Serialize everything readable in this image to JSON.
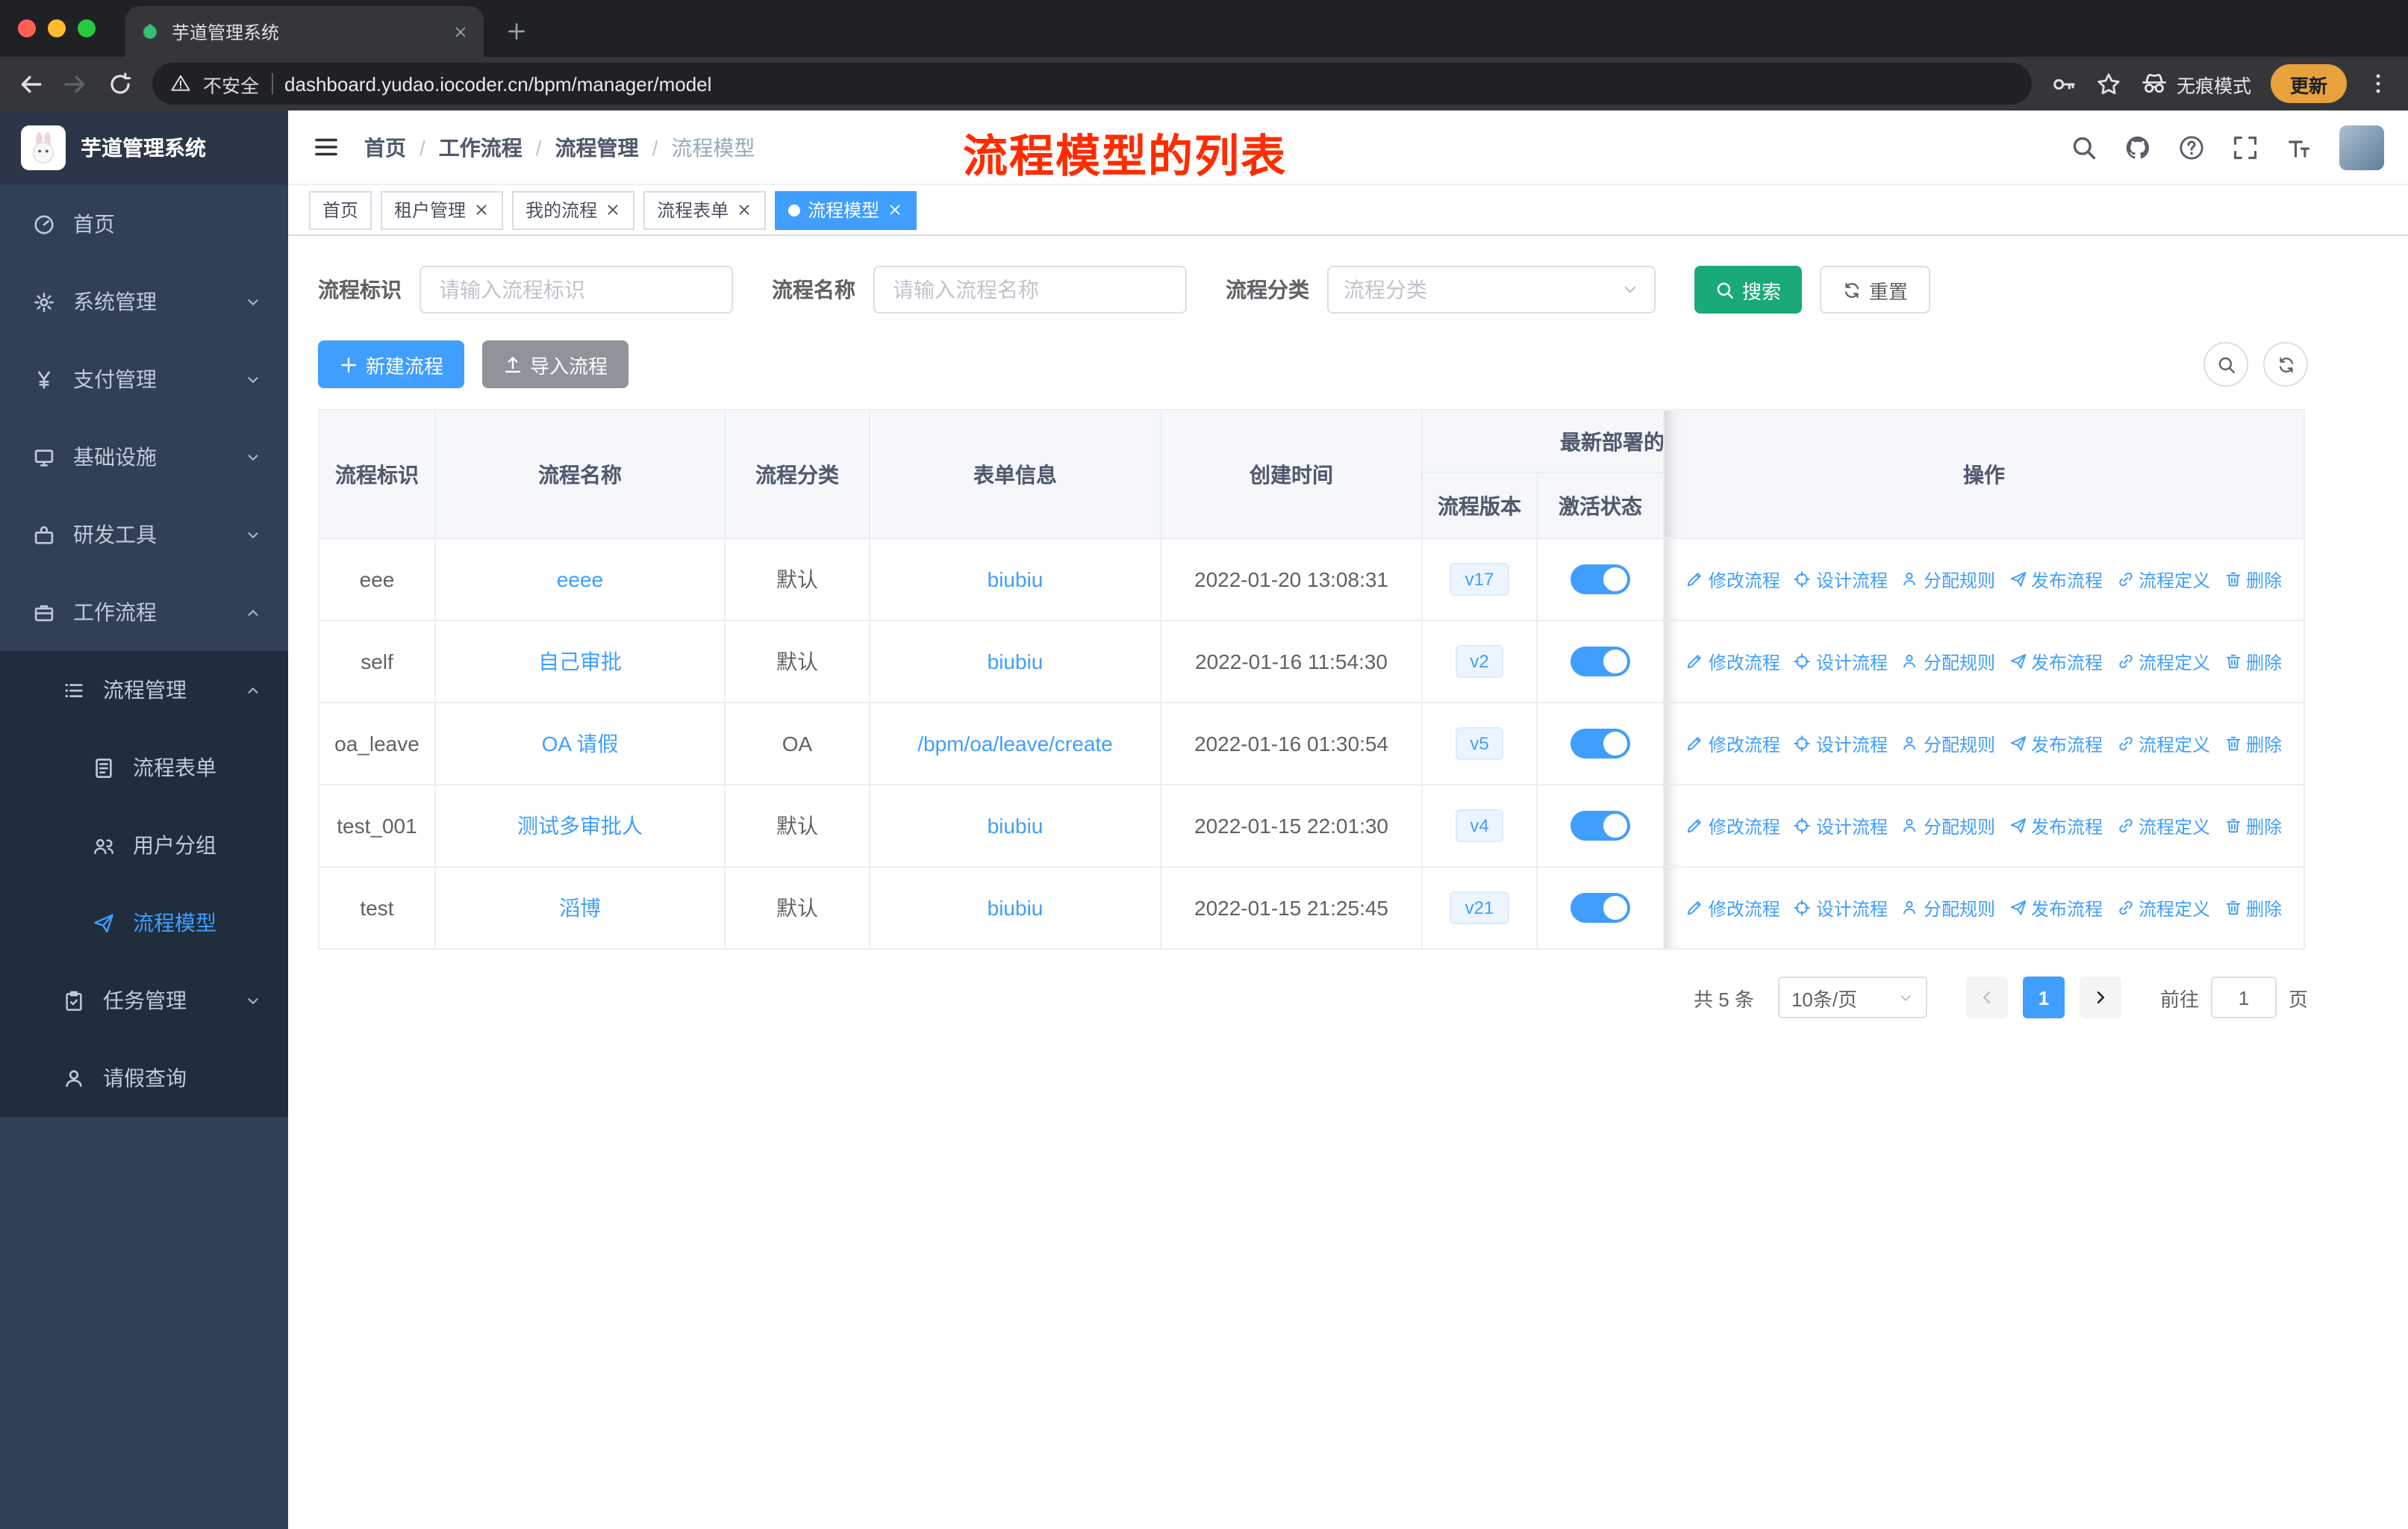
{
  "colors": {
    "primary": "#409EFF",
    "search_button_green": "#1AA97B",
    "import_button_gray": "#909399",
    "sidebar_bg": "#304156",
    "sidebar_submenu_bg": "#1F2D3D",
    "annotation_red": "#FF2C00",
    "active_tag_bg": "#409EFF",
    "toggle_on": "#409EFF",
    "update_pill_orange": "#E8A23C"
  },
  "browser": {
    "tab": {
      "title": "芋道管理系统"
    },
    "address": {
      "security_label": "不安全",
      "url": "dashboard.yudao.iocoder.cn/bpm/manager/model"
    },
    "incognito_label": "无痕模式",
    "update_label": "更新"
  },
  "sidebar": {
    "logo_text": "芋道管理系统",
    "items": [
      {
        "id": "home",
        "label": "首页",
        "icon": "dashboard-icon",
        "level": 1
      },
      {
        "id": "system",
        "label": "系统管理",
        "icon": "gear-icon",
        "level": 1,
        "chevron": "down"
      },
      {
        "id": "payment",
        "label": "支付管理",
        "icon": "yen-icon",
        "level": 1,
        "chevron": "down"
      },
      {
        "id": "infra",
        "label": "基础设施",
        "icon": "infra-icon",
        "level": 1,
        "chevron": "down"
      },
      {
        "id": "devtools",
        "label": "研发工具",
        "icon": "tools-icon",
        "level": 1,
        "chevron": "down"
      },
      {
        "id": "workflow",
        "label": "工作流程",
        "icon": "briefcase-icon",
        "level": 1,
        "chevron": "up"
      },
      {
        "id": "process-manage",
        "label": "流程管理",
        "icon": "list-icon",
        "level": 2,
        "chevron": "up",
        "sub": true
      },
      {
        "id": "process-form",
        "label": "流程表单",
        "icon": "form-icon",
        "level": 3,
        "sub": true
      },
      {
        "id": "user-group",
        "label": "用户分组",
        "icon": "group-icon",
        "level": 3,
        "sub": true
      },
      {
        "id": "process-model",
        "label": "流程模型",
        "icon": "send-icon",
        "level": 3,
        "sub": true,
        "active": true
      },
      {
        "id": "task-manage",
        "label": "任务管理",
        "icon": "task-icon",
        "level": 2,
        "chevron": "down",
        "sub": true
      },
      {
        "id": "leave-query",
        "label": "请假查询",
        "icon": "user-icon",
        "level": 2,
        "sub": true
      }
    ]
  },
  "header": {
    "breadcrumb": [
      "首页",
      "工作流程",
      "流程管理",
      "流程模型"
    ],
    "annotation": "流程模型的列表"
  },
  "tags_view": [
    {
      "label": "首页",
      "closable": false,
      "active": false
    },
    {
      "label": "租户管理",
      "closable": true,
      "active": false
    },
    {
      "label": "我的流程",
      "closable": true,
      "active": false
    },
    {
      "label": "流程表单",
      "closable": true,
      "active": false
    },
    {
      "label": "流程模型",
      "closable": true,
      "active": true
    }
  ],
  "filters": {
    "id": {
      "label": "流程标识",
      "placeholder": "请输入流程标识"
    },
    "name": {
      "label": "流程名称",
      "placeholder": "请输入流程名称"
    },
    "category": {
      "label": "流程分类",
      "placeholder": "流程分类"
    },
    "search_label": "搜索",
    "reset_label": "重置"
  },
  "toolbar": {
    "create_label": "新建流程",
    "import_label": "导入流程"
  },
  "table": {
    "headers": {
      "id": "流程标识",
      "name": "流程名称",
      "category": "流程分类",
      "form": "表单信息",
      "created": "创建时间",
      "deploy_group": "最新部署的",
      "version": "流程版本",
      "status": "激活状态",
      "actions": "操作"
    },
    "rows": [
      {
        "id": "eee",
        "name": "eeee",
        "category": "默认",
        "form": "biubiu",
        "created": "2022-01-20 13:08:31",
        "version": "v17",
        "active": true
      },
      {
        "id": "self",
        "name": "自己审批",
        "category": "默认",
        "form": "biubiu",
        "created": "2022-01-16 11:54:30",
        "version": "v2",
        "active": true
      },
      {
        "id": "oa_leave",
        "name": "OA 请假",
        "category": "OA",
        "form": "/bpm/oa/leave/create",
        "created": "2022-01-16 01:30:54",
        "version": "v5",
        "active": true
      },
      {
        "id": "test_001",
        "name": "测试多审批人",
        "category": "默认",
        "form": "biubiu",
        "created": "2022-01-15 22:01:30",
        "version": "v4",
        "active": true
      },
      {
        "id": "test",
        "name": "滔博",
        "category": "默认",
        "form": "biubiu",
        "created": "2022-01-15 21:25:45",
        "version": "v21",
        "active": true
      }
    ],
    "row_actions": [
      {
        "id": "modify",
        "label": "修改流程",
        "icon": "edit-icon"
      },
      {
        "id": "design",
        "label": "设计流程",
        "icon": "design-icon"
      },
      {
        "id": "assign",
        "label": "分配规则",
        "icon": "assign-icon"
      },
      {
        "id": "publish",
        "label": "发布流程",
        "icon": "publish-icon"
      },
      {
        "id": "definition",
        "label": "流程定义",
        "icon": "link-icon"
      },
      {
        "id": "delete",
        "label": "删除",
        "icon": "delete-icon"
      }
    ]
  },
  "pagination": {
    "total_text": "共 5 条",
    "page_size_text": "10条/页",
    "current_page": "1",
    "goto_label": "前往",
    "goto_value": "1",
    "page_unit": "页"
  }
}
